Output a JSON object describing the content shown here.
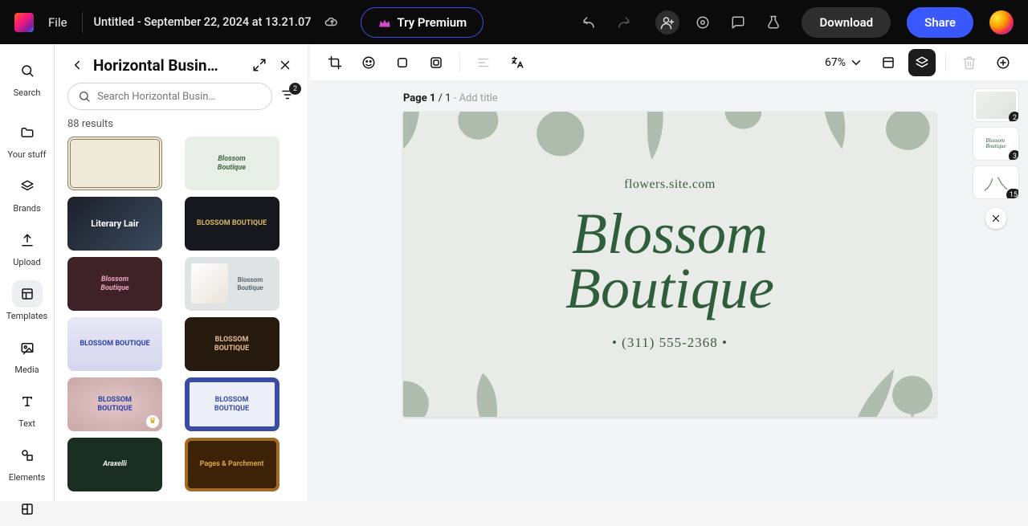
{
  "topbar": {
    "file_label": "File",
    "doc_title": "Untitled - September 22, 2024 at 13.21.07",
    "premium_label": "Try Premium",
    "download_label": "Download",
    "share_label": "Share"
  },
  "rail": {
    "search": "Search",
    "your_stuff": "Your stuff",
    "brands": "Brands",
    "upload": "Upload",
    "templates": "Templates",
    "media": "Media",
    "text": "Text",
    "elements": "Elements"
  },
  "panel": {
    "title": "Horizontal Busin…",
    "search_placeholder": "Search Horizontal Busin…",
    "filter_badge": "2",
    "results": "88 results",
    "templates": [
      {
        "label": ""
      },
      {
        "label": "Blossom\nBoutique"
      },
      {
        "label": "Literary Lair"
      },
      {
        "label": "BLOSSOM BOUTIQUE"
      },
      {
        "label": "Blossom\nBoutique"
      },
      {
        "label": "Blossom\nBoutique"
      },
      {
        "label": "BLOSSOM BOUTIQUE"
      },
      {
        "label": "BLOSSOM\nBOUTIQUE"
      },
      {
        "label": "BLOSSOM\nBOUTIQUE"
      },
      {
        "label": "BLOSSOM\nBOUTIQUE"
      },
      {
        "label": "Araxelli"
      },
      {
        "label": "Pages & Parchment"
      }
    ]
  },
  "canvasbar": {
    "zoom": "67%"
  },
  "page": {
    "num": "Page 1",
    "of": " / 1 ",
    "hint": "- Add title",
    "card": {
      "site": "flowers.site.com",
      "brand1": "Blossom",
      "brand2": "Boutique",
      "phone": "•  (311) 555-2368  •"
    }
  },
  "strip": {
    "t1_badge": "2",
    "t2_badge": "3",
    "t2_text": "Blossom\nBoutique",
    "t3_badge": "15"
  }
}
